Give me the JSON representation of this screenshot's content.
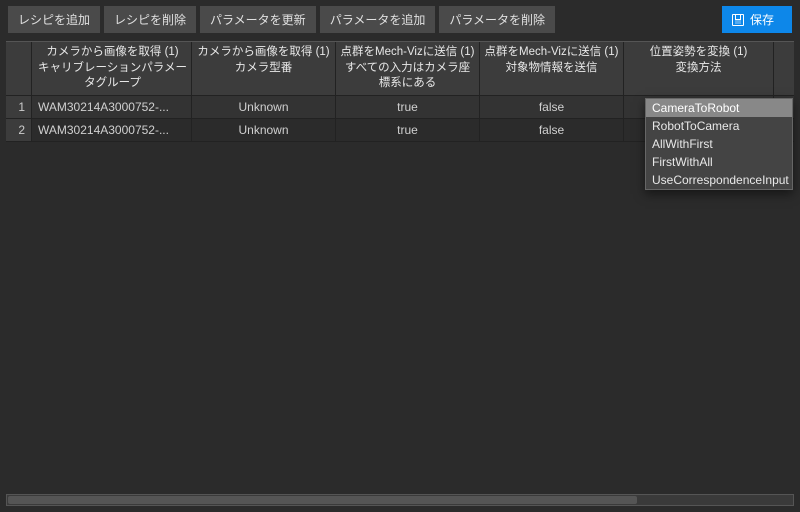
{
  "toolbar": {
    "add_recipe": "レシピを追加",
    "delete_recipe": "レシピを削除",
    "update_param": "パラメータを更新",
    "add_param": "パラメータを追加",
    "delete_param": "パラメータを削除",
    "save": "保存"
  },
  "columns": {
    "c1_line1": "カメラから画像を取得 (1)",
    "c1_line2": "キャリブレーションパラメータグループ",
    "c2_line1": "カメラから画像を取得 (1)",
    "c2_line2": "カメラ型番",
    "c3_line1": "点群をMech-Vizに送信 (1)",
    "c3_line2": "すべての入力はカメラ座標系にある",
    "c4_line1": "点群をMech-Vizに送信 (1)",
    "c4_line2": "対象物情報を送信",
    "c5_line1": "位置姿勢を変換 (1)",
    "c5_line2": "変換方法"
  },
  "rows": [
    {
      "idx": "1",
      "c1": "WAM30214A3000752-...",
      "c2": "Unknown",
      "c3": "true",
      "c4": "false",
      "c5": "CameraToRobot"
    },
    {
      "idx": "2",
      "c1": "WAM30214A3000752-...",
      "c2": "Unknown",
      "c3": "true",
      "c4": "false",
      "c5": ""
    }
  ],
  "dropdown": {
    "options": [
      "CameraToRobot",
      "RobotToCamera",
      "AllWithFirst",
      "FirstWithAll",
      "UseCorrespondenceInput"
    ],
    "selected_index": 0
  }
}
